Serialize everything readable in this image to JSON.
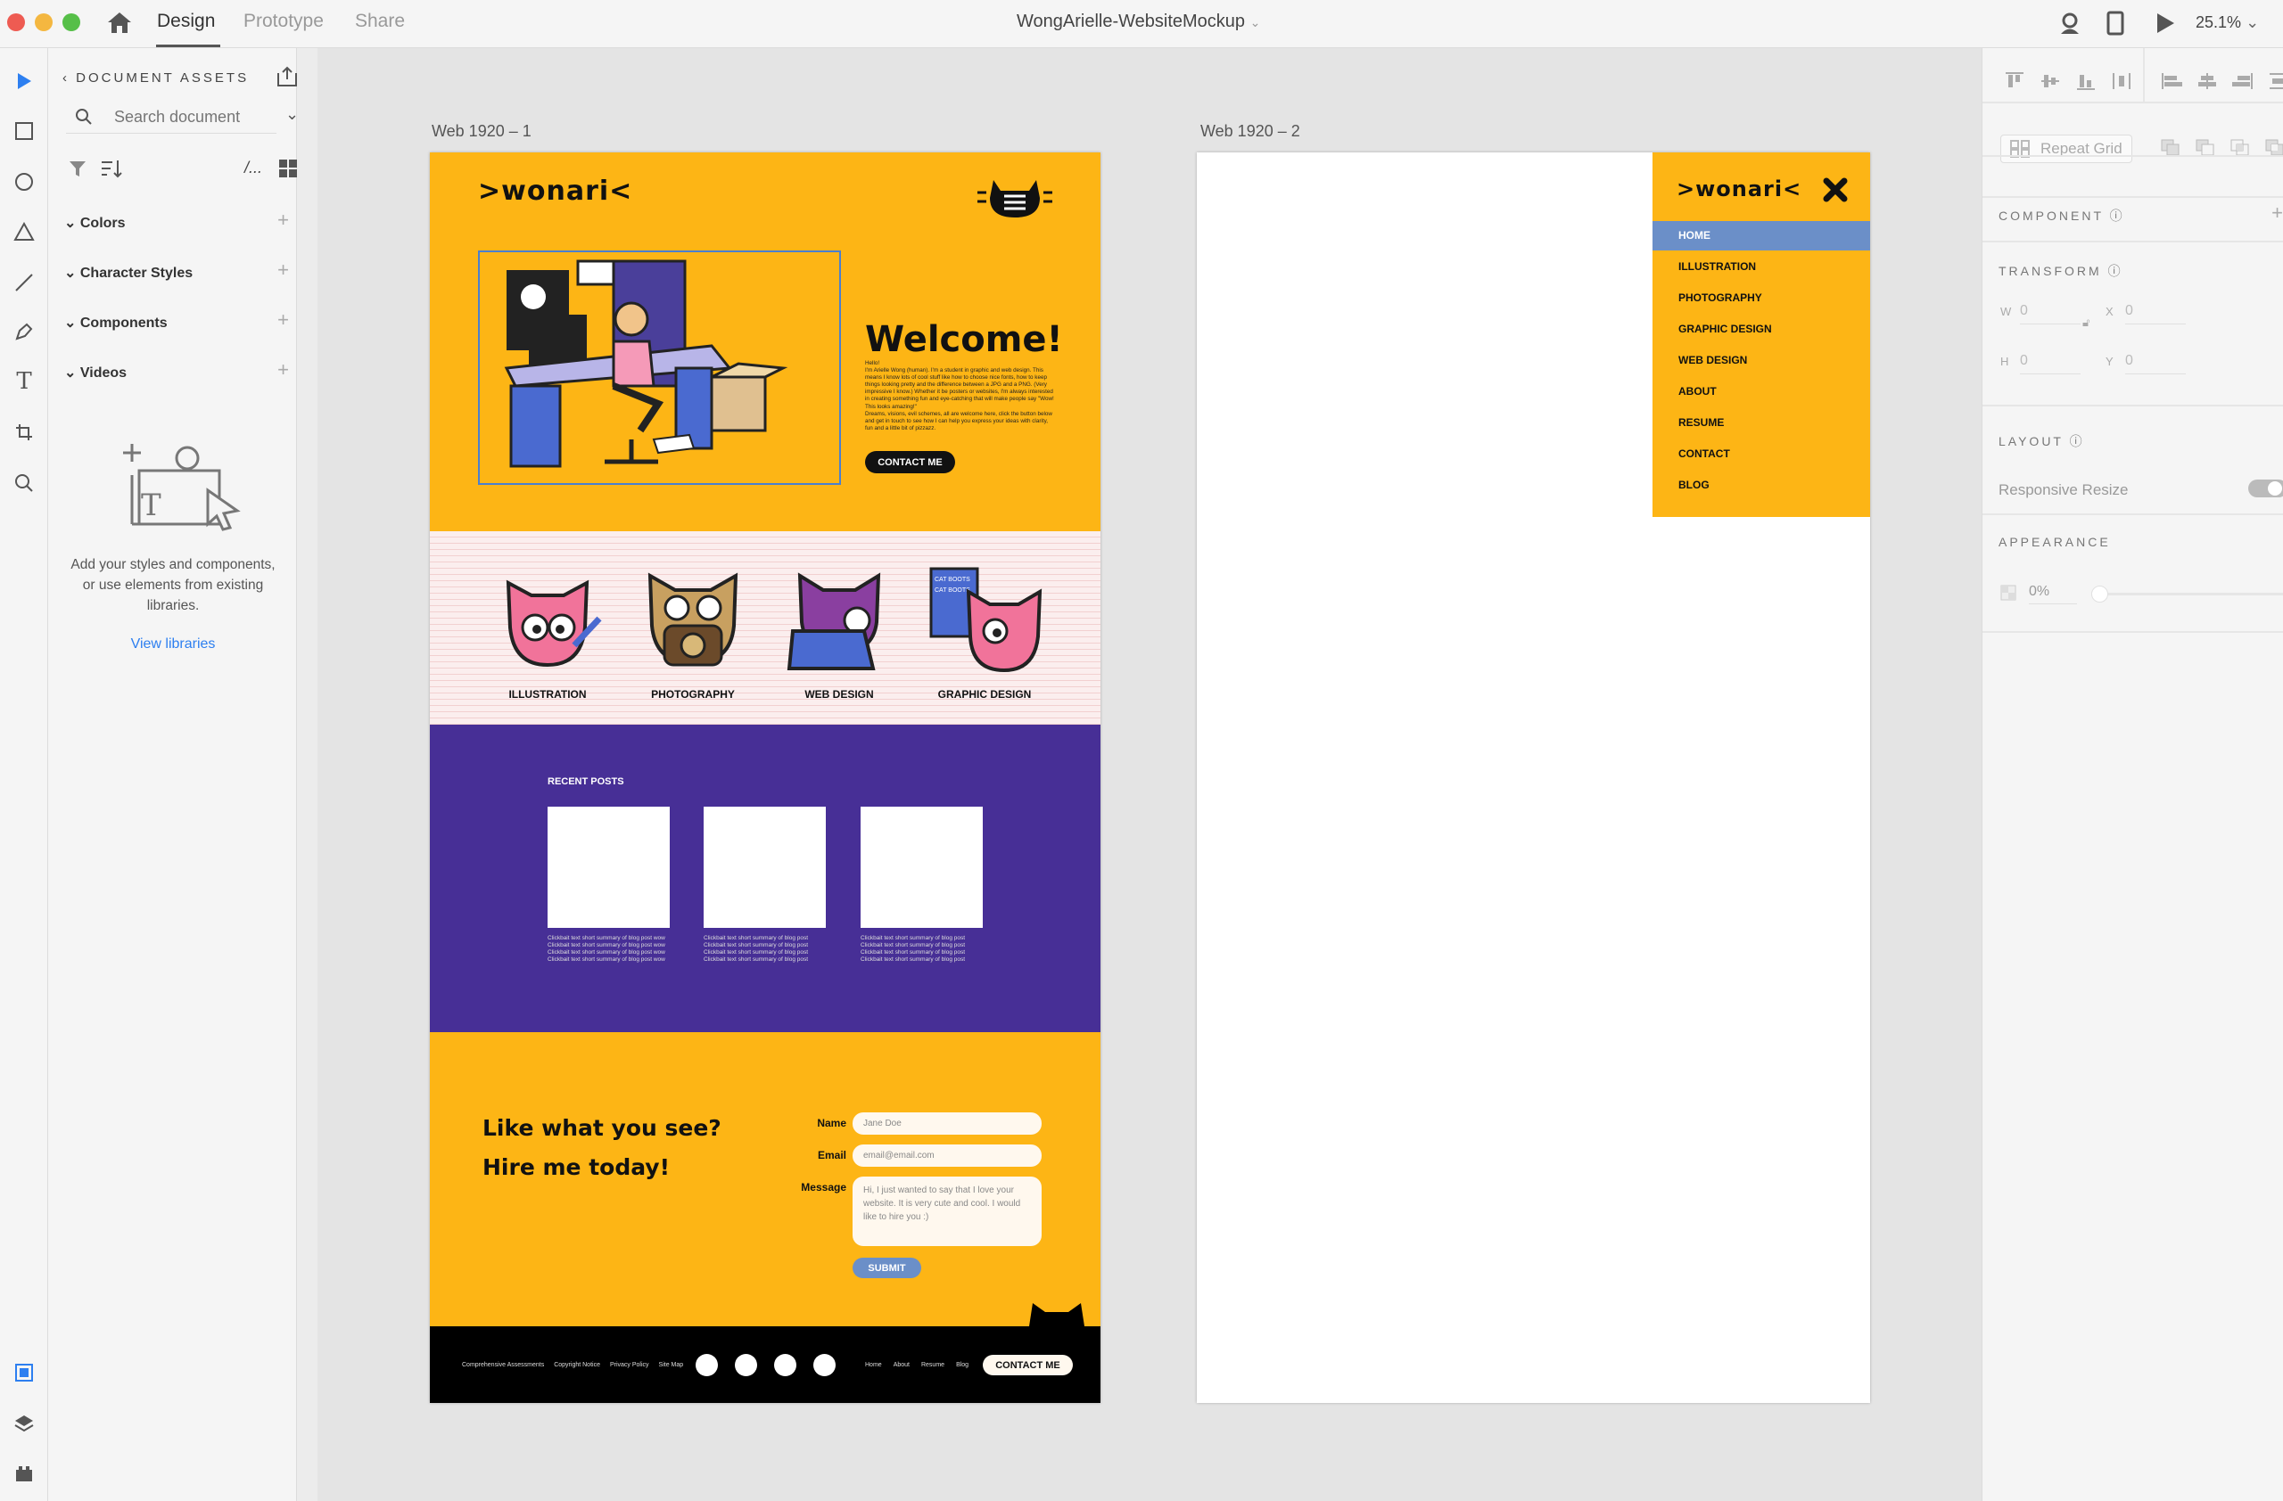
{
  "app": {
    "tabs": [
      "Design",
      "Prototype",
      "Share"
    ],
    "active_tab": "Design",
    "doc_title": "WongArielle-WebsiteMockup",
    "zoom": "25.1%"
  },
  "assets": {
    "title": "DOCUMENT ASSETS",
    "search_placeholder": "Search document",
    "path_label": "/...",
    "sections": [
      "Colors",
      "Character Styles",
      "Components",
      "Videos"
    ],
    "empty_text": [
      "Add your styles and components,",
      "or use elements from existing",
      "libraries."
    ],
    "view_libraries": "View libraries"
  },
  "right_panel": {
    "repeat_grid": "Repeat Grid",
    "component": "COMPONENT",
    "transform": "TRANSFORM",
    "w_label": "W",
    "w": "0",
    "h_label": "H",
    "h": "0",
    "x_label": "X",
    "x": "0",
    "y_label": "Y",
    "y": "0",
    "layout": "LAYOUT",
    "responsive_resize": "Responsive Resize",
    "responsive_on": true,
    "appearance": "APPEARANCE",
    "opacity": "0%"
  },
  "artboards": [
    {
      "label": "Web 1920 – 1"
    },
    {
      "label": "Web 1920 – 2"
    }
  ],
  "site": {
    "logo": ">wonari<",
    "colors": {
      "yellow": "#fdb515",
      "purple": "#472f96",
      "blue": "#6b8fc8",
      "black": "#000000"
    },
    "hero": {
      "title": "Welcome!",
      "greeting": "Hello!",
      "body": "I'm Arielle Wong (human). I'm a student in graphic and web design. This means I know lots of cool stuff like how to choose nice fonts, how to keep things looking pretty and the difference between a JPG and a PNG. (Very impressive I know.) Whether it be posters or websites, I'm always interested in creating something fun and eye-catching that will make people say \"Wow! This looks amazing!\"",
      "body2": "Dreams, visions, evil schemes, all are welcome here, click the button below and get in touch to see how I can help you express your ideas with clarity, fun and a little bit of pizzazz.",
      "cta": "CONTACT ME"
    },
    "categories": [
      "ILLUSTRATION",
      "PHOTOGRAPHY",
      "WEB DESIGN",
      "GRAPHIC DESIGN"
    ],
    "poster_text": "CAT BOOTS",
    "recent": {
      "title": "RECENT POSTS",
      "posts": [
        [
          "Clickbait text short summary of blog post  wow",
          "Clickbait text short summary of blog post  wow",
          "Clickbait text short summary of blog post wow",
          "Clickbait text short summary of blog post wow"
        ],
        [
          "Clickbait text short summary of blog post",
          "Clickbait text short summary of blog post",
          "Clickbait text short summary of blog post",
          "Clickbait text short summary of blog post"
        ],
        [
          "Clickbait text short summary of blog post",
          "Clickbait text short summary of blog post",
          "Clickbait text short summary of blog post",
          "Clickbait text short summary of blog post"
        ]
      ]
    },
    "contact": {
      "line1": "Like what you see?",
      "line2": "Hire me today!",
      "name_label": "Name",
      "name_value": "Jane Doe",
      "email_label": "Email",
      "email_value": "email@email.com",
      "message_label": "Message",
      "message_value": "Hi, I just wanted to say that I love your website. It is very cute and cool. I would like to hire you :)",
      "submit": "SUBMIT"
    },
    "footer": {
      "left_links": [
        "Comprehensive Assessments",
        "Copyright Notice",
        "Privacy Policy",
        "Site Map"
      ],
      "right_links": [
        "Home",
        "About",
        "Resume",
        "Blog"
      ],
      "cta": "CONTACT ME"
    },
    "menu": {
      "items": [
        "HOME",
        "ILLUSTRATION",
        "PHOTOGRAPHY",
        "GRAPHIC DESIGN",
        "WEB DESIGN",
        "ABOUT",
        "RESUME",
        "CONTACT",
        "BLOG"
      ],
      "active": "HOME"
    }
  }
}
